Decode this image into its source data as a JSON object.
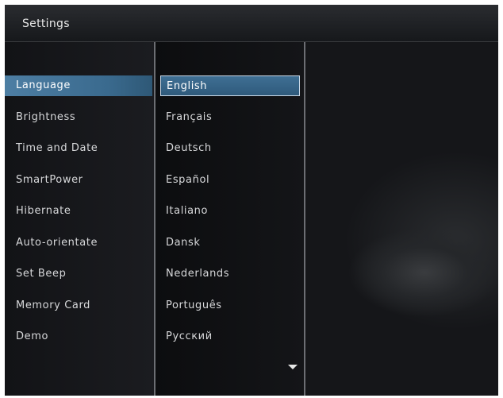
{
  "title": "Settings",
  "menu": [
    {
      "label": "Language"
    },
    {
      "label": "Brightness"
    },
    {
      "label": "Time and Date"
    },
    {
      "label": "SmartPower"
    },
    {
      "label": "Hibernate"
    },
    {
      "label": "Auto-orientate"
    },
    {
      "label": "Set Beep"
    },
    {
      "label": "Memory Card"
    },
    {
      "label": "Demo"
    }
  ],
  "selected_menu": "Language",
  "languages": [
    {
      "label": "English"
    },
    {
      "label": "Français"
    },
    {
      "label": "Deutsch"
    },
    {
      "label": "Español"
    },
    {
      "label": "Italiano"
    },
    {
      "label": "Dansk"
    },
    {
      "label": "Nederlands"
    },
    {
      "label": "Português"
    },
    {
      "label": "Русский"
    }
  ],
  "selected_language": "English",
  "colors": {
    "highlight": "#3f6f94",
    "background": "#0b0c0e",
    "text": "#d7d8da"
  },
  "icons": {
    "scroll_down": "triangle-down-icon"
  }
}
